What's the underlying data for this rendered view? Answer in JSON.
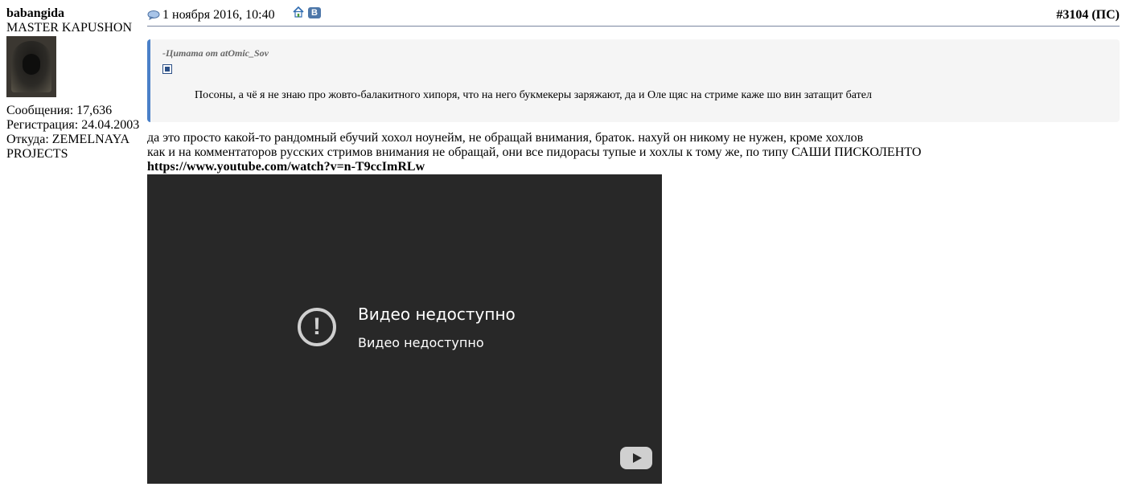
{
  "user": {
    "name": "babangida",
    "title": "MASTER KAPUSHON",
    "posts": "Сообщения: 17,636",
    "registration": "Регистрация: 24.04.2003",
    "location": "Откуда: ZEMELNAYA PROJECTS"
  },
  "post": {
    "date": "1 ноября 2016, 10:40",
    "number": "#3104",
    "number_suffix": " (ПС)",
    "quote": {
      "author": "-Цитата от atOmic_Sov",
      "text": "Посоны, а чё я не знаю про жовто-балакитного хипоря, что на него букмекеры заряжают, да и Оле щяс на стриме каже шо вин затащит бател"
    },
    "lines": [
      "да это просто какой-то рандомный ебучий хохол ноунейм, не обращай внимания, браток. нахуй он никому не нужен, кроме хохлов",
      "как и на комментаторов русских стримов внимания не обращай, они все пидорасы тупые и хохлы к тому же, по типу САШИ ПИСКОЛЕНТО"
    ],
    "link": "https://www.youtube.com/watch?v=n-T9ccImRLw",
    "video": {
      "title": "Видео недоступно",
      "subtitle": "Видео недоступно"
    }
  },
  "icons": {
    "post": "speech-bubble-icon",
    "home": "home-icon",
    "vk": "vk-icon",
    "vk_letter": "В"
  },
  "colors": {
    "quote_border": "#4a80c8",
    "video_bg": "#282828",
    "vk": "#4d77a9"
  }
}
